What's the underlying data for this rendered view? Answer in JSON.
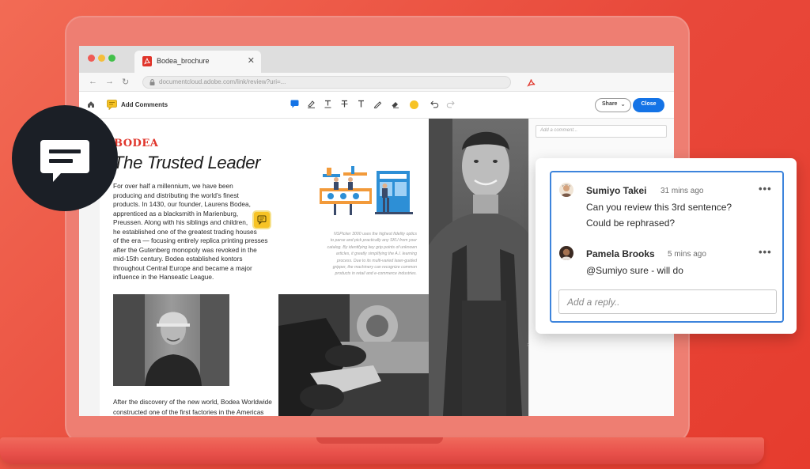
{
  "browser": {
    "tab_title": "Bodea_brochure",
    "tab_close": "✕",
    "url": "documentcloud.adobe.com/link/review?uri=..."
  },
  "toolbar": {
    "add_comments_label": "Add Comments",
    "share_label": "Share",
    "close_label": "Close",
    "highlight_color": "#f7c325"
  },
  "document": {
    "brand": "BODEA",
    "headline": "The Trusted Leader",
    "body1_lines": [
      "For over half a millennium, we have been",
      "producing and distributing the world’s finest",
      "products. In 1430, our founder, Laurens Bodea,",
      "apprenticed as a blacksmith in Marienburg,",
      "Preussen. Along with his siblings and children,",
      "he established one of the greatest trading houses",
      "of the era — focusing entirely replica printing presses",
      "after the Gutenberg monopoly was revoked in the",
      "mid-15th century. Bodea established kontors",
      "throughout Central Europe and became a major",
      "influence in the Hanseatic League."
    ],
    "caption_lines": [
      "NSPicker 3000 uses the highest fidelity optics",
      "to parse and pick practically any SKU from your",
      "catalog. By identifying key grip points of unknown",
      "articles, it greatly simplifying the A.I. learning",
      "process. Due to its multi-varied laser-guided",
      "gripper, the machinery can recognize common",
      "products in retail and e-commerce industries."
    ],
    "body2_lines": [
      "After the discovery of the new world, Bodea Worldwide",
      "constructed one of the first factories in the Americas"
    ]
  },
  "comments_panel": {
    "placeholder": "Add a comment..."
  },
  "comment_card": {
    "comments": [
      {
        "author": "Sumiyo Takei",
        "time": "31 mins ago",
        "lines": [
          "Can you review this 3rd sentence?",
          "Could be rephrased?"
        ]
      },
      {
        "author": "Pamela Brooks",
        "time": "5 mins ago",
        "lines": [
          "@Sumiyo sure - will do"
        ]
      }
    ],
    "more_label": "•••",
    "reply_placeholder": "Add a reply.."
  },
  "colors": {
    "background": "#ec5a48",
    "adobe_red": "#e0342a",
    "primary_blue": "#1473e6",
    "badge": "#1b1f26"
  },
  "icons": [
    "comment-bubble-icon",
    "pdf-icon",
    "home-icon",
    "add-comment-icon",
    "sticky-note-icon",
    "lock-icon",
    "undo-icon",
    "redo-icon"
  ]
}
